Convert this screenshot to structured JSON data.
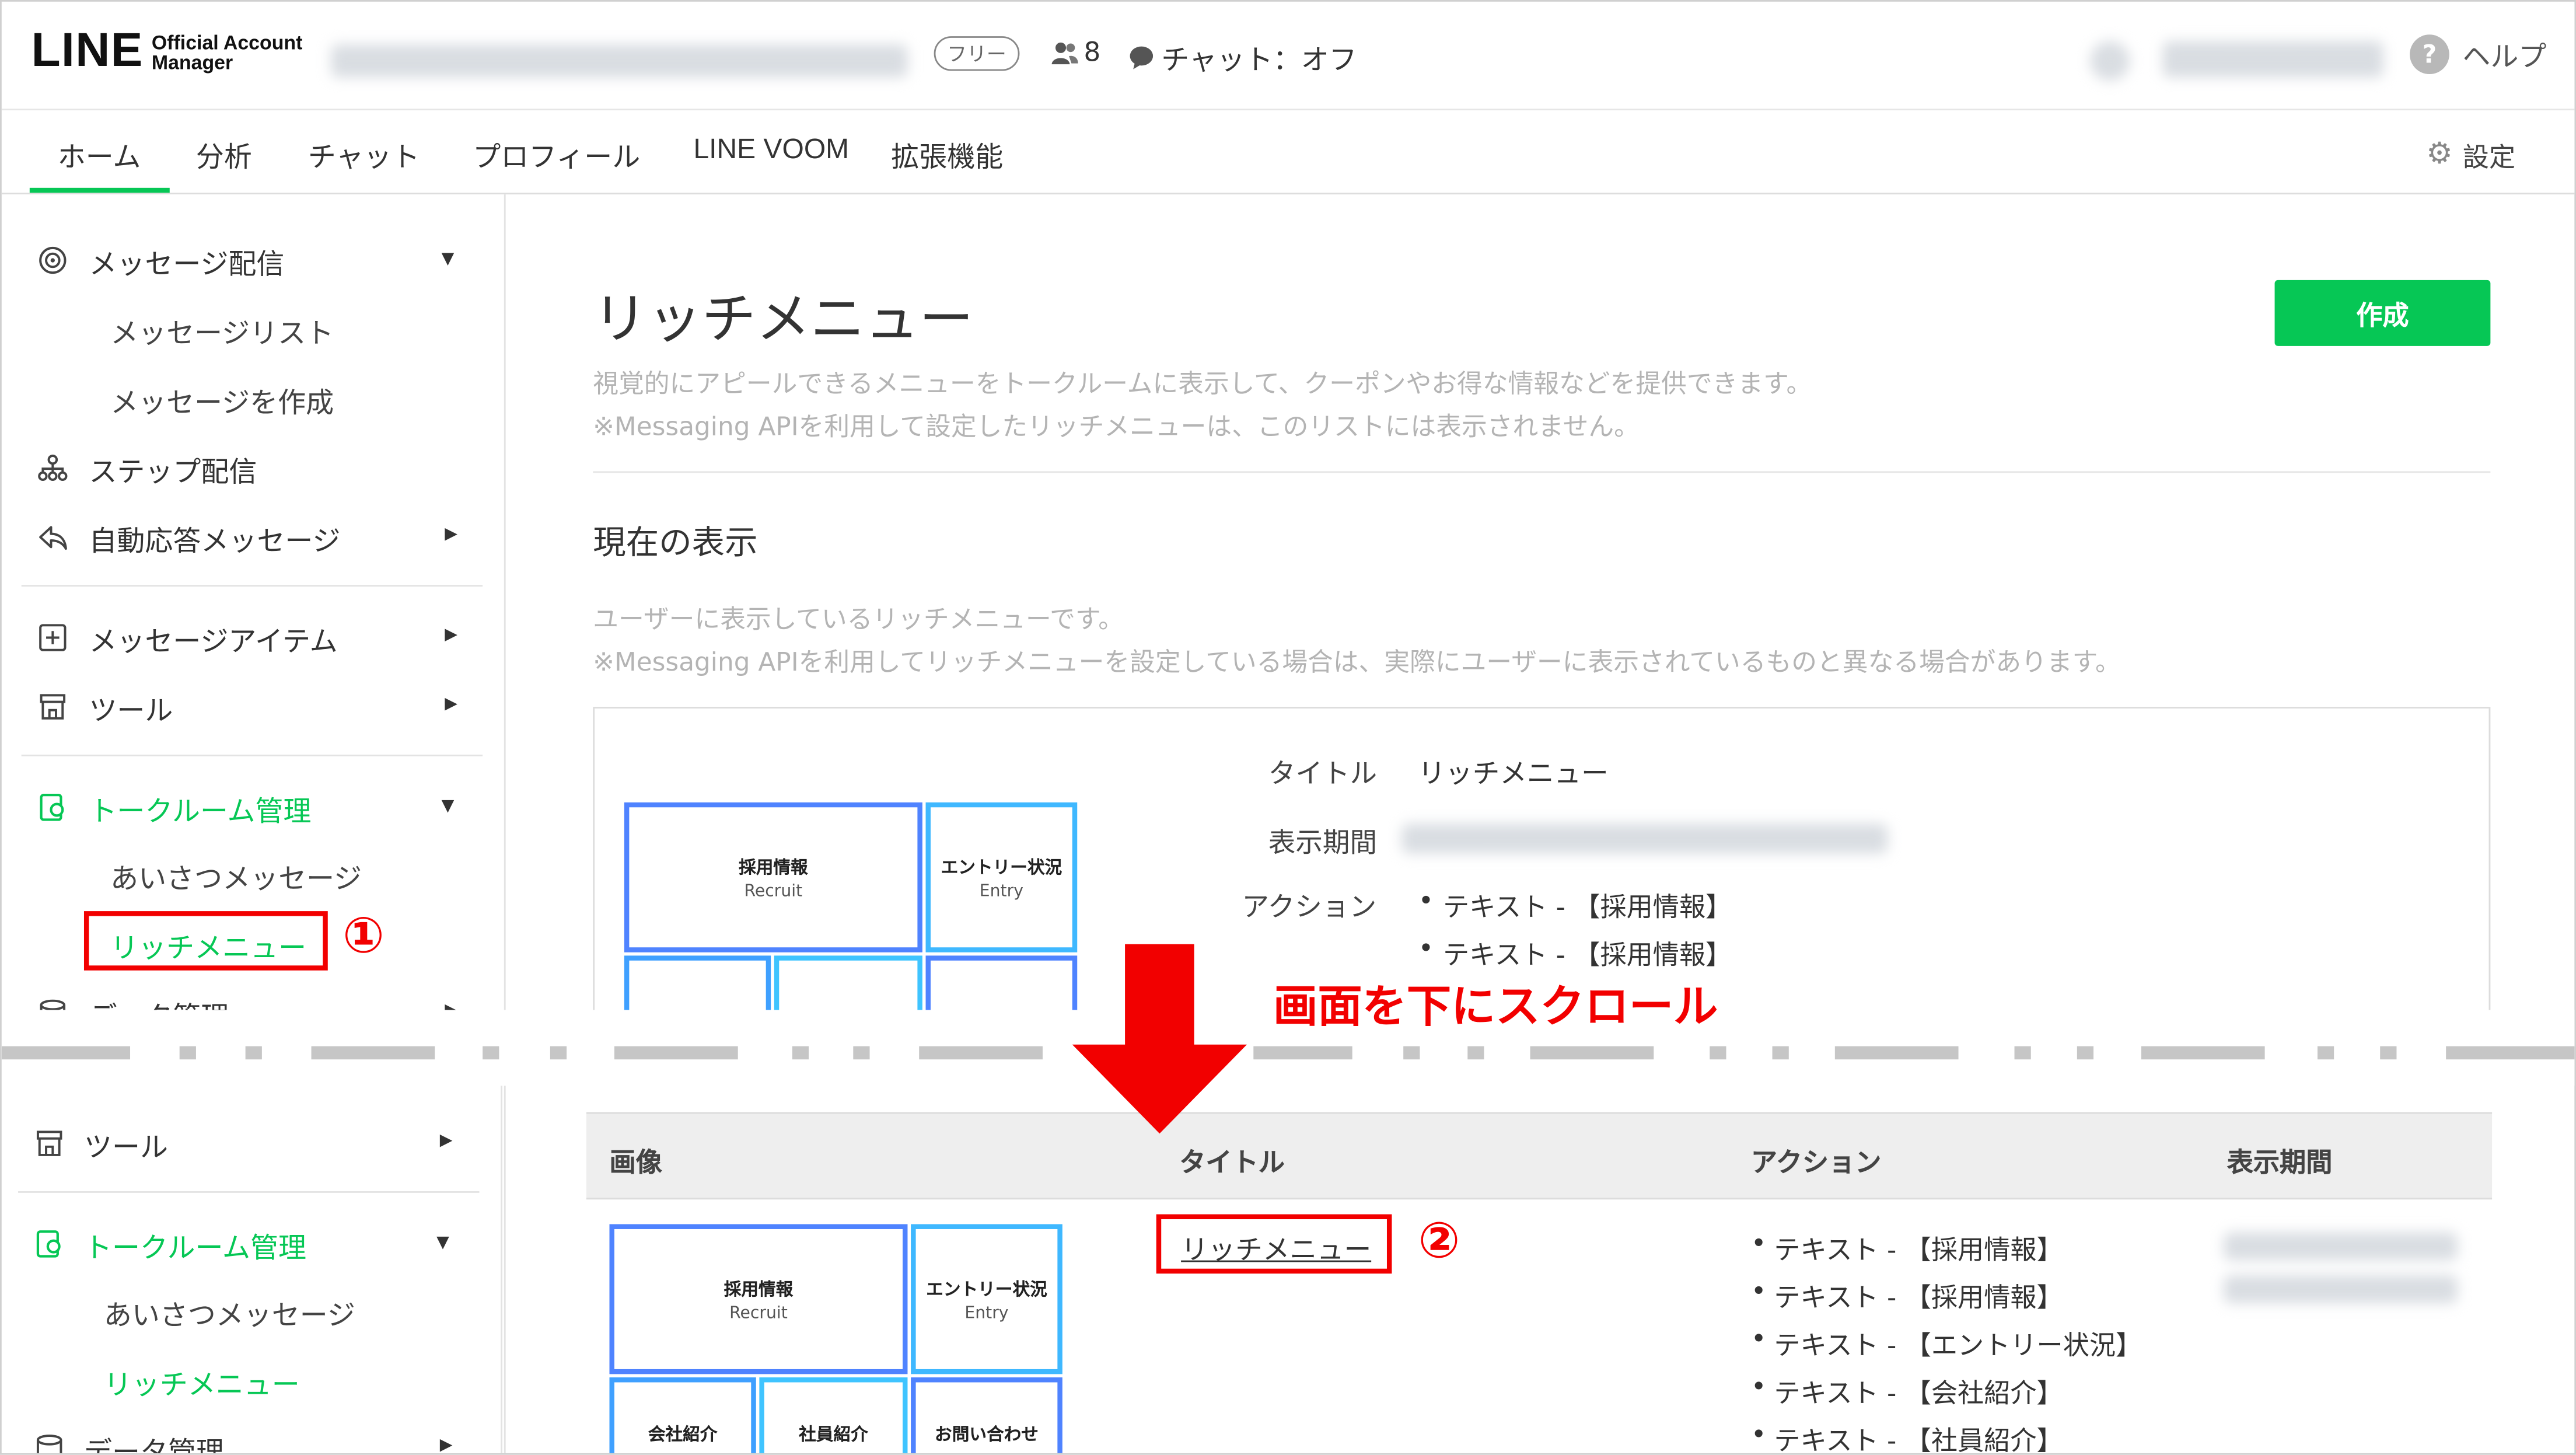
{
  "logo": {
    "line": "LINE",
    "official_line1": "Official Account",
    "official_line2": "Manager"
  },
  "header": {
    "plan_badge": "フリー",
    "friends_count": "8",
    "chat_status": "チャット：オフ",
    "help_label": "ヘルプ"
  },
  "nav": {
    "tabs": [
      "ホーム",
      "分析",
      "チャット",
      "プロフィール",
      "LINE VOOM",
      "拡張機能"
    ],
    "settings_label": "設定"
  },
  "sidebar_top": {
    "message_delivery": "メッセージ配信",
    "message_list": "メッセージリスト",
    "create_message": "メッセージを作成",
    "step_delivery": "ステップ配信",
    "auto_reply": "自動応答メッセージ",
    "message_items": "メッセージアイテム",
    "tools": "ツール",
    "talkroom_mgmt": "トークルーム管理",
    "greeting": "あいさつメッセージ",
    "rich_menu": "リッチメニュー",
    "data_mgmt": "データ管理"
  },
  "sidebar_bottom": {
    "tools": "ツール",
    "talkroom_mgmt": "トークルーム管理",
    "greeting": "あいさつメッセージ",
    "rich_menu": "リッチメニュー",
    "data_mgmt": "データ管理"
  },
  "main": {
    "page_title": "リッチメニュー",
    "create_button": "作成",
    "description_1": "視覚的にアピールできるメニューをトークルームに表示して、クーポンやお得な情報などを提供できます。",
    "description_2": "※Messaging APIを利用して設定したリッチメニューは、このリストには表示されません。",
    "current_heading": "現在の表示",
    "current_desc_1": "ユーザーに表示しているリッチメニューです。",
    "current_desc_2": "※Messaging APIを利用してリッチメニューを設定している場合は、実際にユーザーに表示されているものと異なる場合があります。",
    "detail": {
      "title_label": "タイトル",
      "title_value": "リッチメニュー",
      "period_label": "表示期間",
      "action_label": "アクション",
      "actions": [
        "テキスト - 【採用情報】",
        "テキスト - 【採用情報】"
      ]
    }
  },
  "preview_tiles": {
    "recruit_jp": "採用情報",
    "recruit_en": "Recruit",
    "entry_jp": "エントリー状況",
    "entry_en": "Entry",
    "company": "会社紹介",
    "staff": "社員紹介",
    "contact": "お問い合わせ"
  },
  "annotations": {
    "step1": "①",
    "step2": "②",
    "scroll_instruction": "画面を下にスクロール"
  },
  "table": {
    "headers": [
      "画像",
      "タイトル",
      "アクション",
      "表示期間"
    ],
    "row": {
      "title": "リッチメニュー",
      "actions": [
        "テキスト - 【採用情報】",
        "テキスト - 【採用情報】",
        "テキスト - 【エントリー状況】",
        "テキスト - 【会社紹介】",
        "テキスト - 【社員紹介】"
      ]
    }
  },
  "colors": {
    "line_green": "#06c755",
    "annotation_red": "#f20000",
    "tile_blue": "#4f83ff",
    "tile_cyan": "#3fd1ff"
  }
}
